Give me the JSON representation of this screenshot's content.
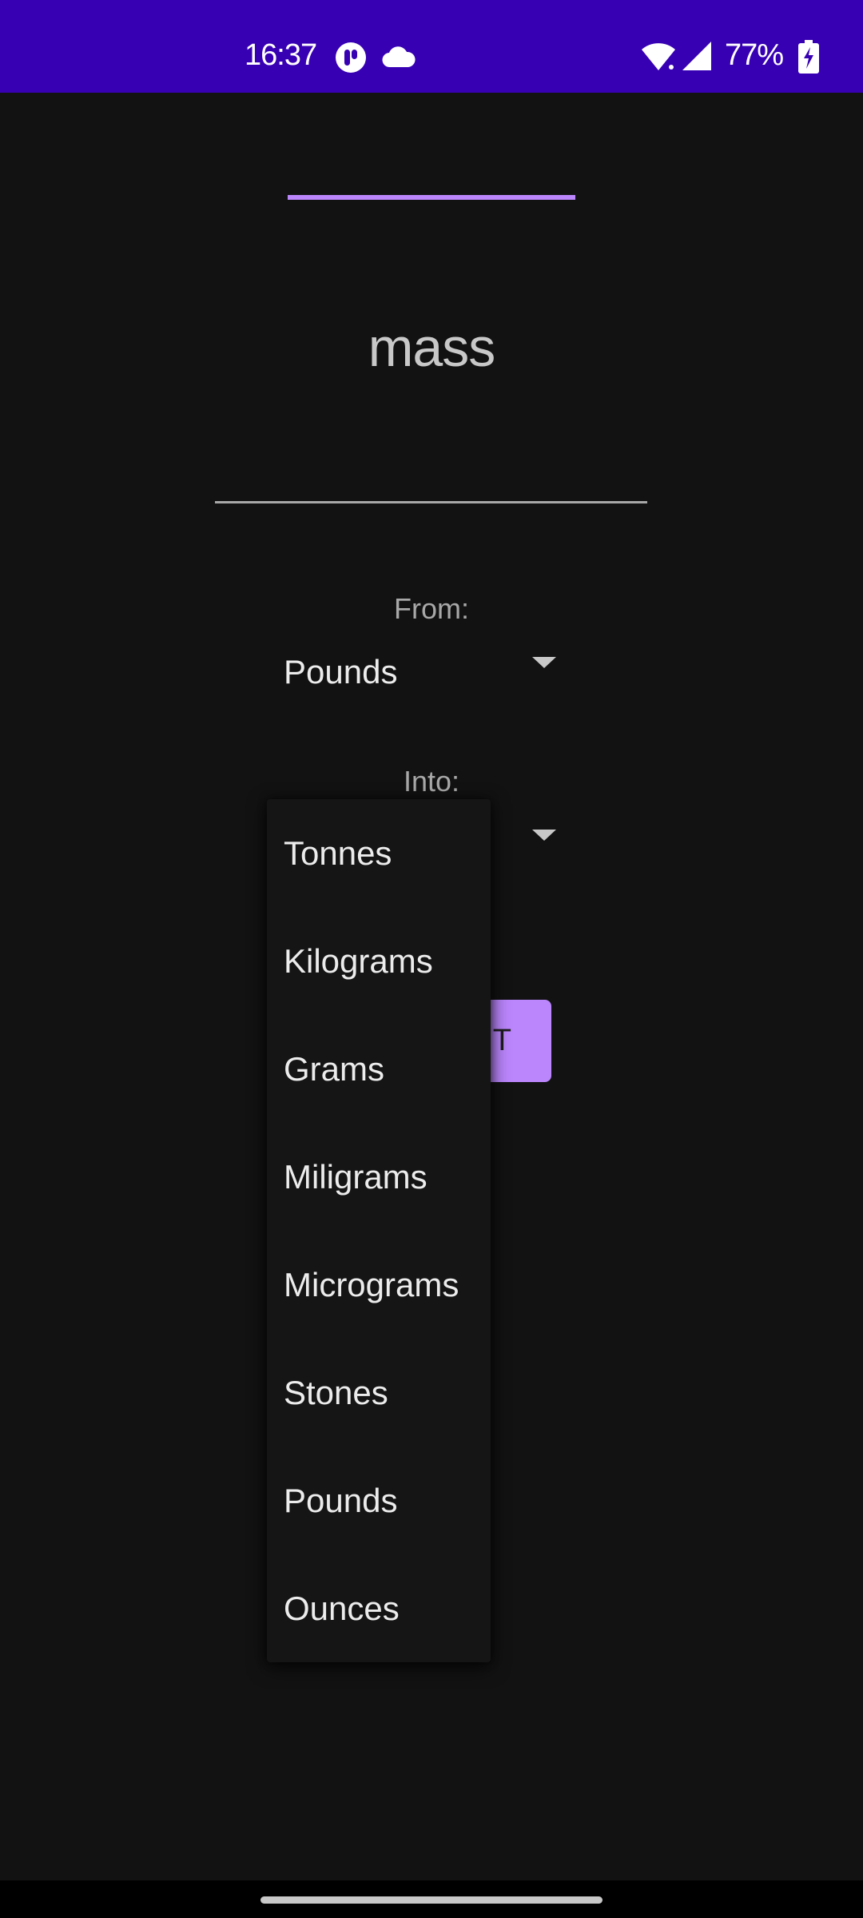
{
  "status_bar": {
    "time": "16:37",
    "battery": "77%",
    "icons": [
      "app-notification-icon",
      "cloud-icon",
      "wifi-icon",
      "cell-signal-icon",
      "battery-charging-icon"
    ]
  },
  "colors": {
    "status_bar_bg": "#3700b3",
    "background": "#121212",
    "accent": "#bb86fc"
  },
  "main": {
    "title": "mass",
    "input_value": "",
    "from_label": "From:",
    "from_value": "Pounds",
    "into_label": "Into:",
    "into_value": "",
    "convert_button": "RT"
  },
  "dropdown": {
    "items": [
      "Tonnes",
      "Kilograms",
      "Grams",
      "Miligrams",
      "Micrograms",
      "Stones",
      "Pounds",
      "Ounces"
    ]
  }
}
